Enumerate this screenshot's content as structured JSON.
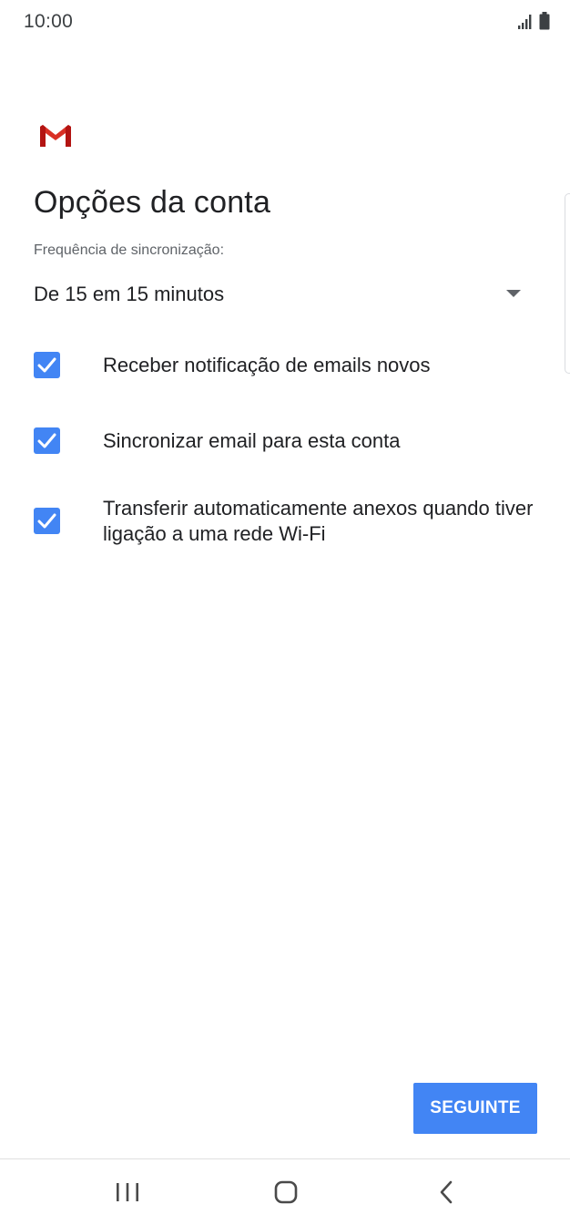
{
  "status_bar": {
    "time": "10:00",
    "icons": [
      "signal-icon",
      "battery-icon"
    ]
  },
  "app": {
    "logo": "gmail-logo",
    "brand_colors": {
      "red": "#d93025",
      "red_dark": "#b31412",
      "accent": "#4285f4"
    }
  },
  "header": {
    "title": "Opções da conta"
  },
  "sync": {
    "label": "Frequência de sincronização:",
    "selected_value": "De 15 em 15 minutos"
  },
  "options": [
    {
      "label": "Receber notificação de emails novos",
      "checked": true
    },
    {
      "label": "Sincronizar email para esta conta",
      "checked": true
    },
    {
      "label": "Transferir automaticamente anexos quando tiver ligação a uma rede Wi-Fi",
      "checked": true
    }
  ],
  "footer": {
    "next_label": "SEGUINTE"
  },
  "nav_bar": {
    "items": [
      "recent-apps-icon",
      "home-icon",
      "back-icon"
    ]
  }
}
